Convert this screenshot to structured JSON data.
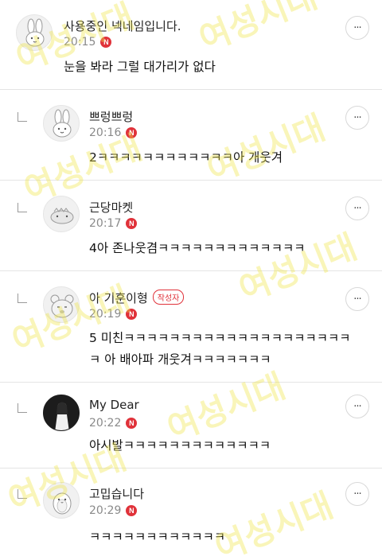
{
  "comments": [
    {
      "nickname": "사용중인 넥네임입니다.",
      "time": "20:15",
      "badge": "N",
      "text": "눈을 봐라 그럴 대가리가 없다",
      "more": "···",
      "avatar_icon": "rabbit-avatar-icon",
      "is_reply": false
    },
    {
      "nickname": "쁘렁쁘렁",
      "time": "20:16",
      "badge": "N",
      "text": "2ㅋㅋㅋㅋㅋㅋㅋㅋㅋㅋㅋㅋ아 개웃겨",
      "more": "···",
      "avatar_icon": "rabbit-avatar-icon",
      "is_reply": true
    },
    {
      "nickname": "근당마켓",
      "time": "20:17",
      "badge": "N",
      "text": "4아 존나웃겸ㅋㅋㅋㅋㅋㅋㅋㅋㅋㅋㅋㅋㅋ",
      "more": "···",
      "avatar_icon": "dino-avatar-icon",
      "is_reply": true
    },
    {
      "nickname": "아 기훈이형",
      "author_label": "작성자",
      "time": "20:19",
      "badge": "N",
      "text": "5 미친ㅋㅋㅋㅋㅋㅋㅋㅋㅋㅋㅋㅋㅋㅋㅋㅋㅋㅋㅋㅋ ㅋ 아 배아파 개웃겨ㅋㅋㅋㅋㅋㅋㅋ",
      "more": "···",
      "avatar_icon": "bear-avatar-icon",
      "is_reply": true
    },
    {
      "nickname": "My Dear",
      "time": "20:22",
      "badge": "N",
      "text": "아시발ㅋㅋㅋㅋㅋㅋㅋㅋㅋㅋㅋㅋㅋ",
      "more": "···",
      "avatar_icon": "photo-avatar-icon",
      "is_reply": true
    },
    {
      "nickname": "고밉습니다",
      "time": "20:29",
      "badge": "N",
      "text": "ㅋㅋㅋㅋㅋㅋㅋㅋㅋㅋㅋㅋ",
      "more": "···",
      "avatar_icon": "penguin-avatar-icon",
      "is_reply": true
    }
  ],
  "watermark": "여성시대",
  "colors": {
    "badge": "#e0323a",
    "watermark": "#eee446",
    "divider": "#e4e4e4"
  }
}
